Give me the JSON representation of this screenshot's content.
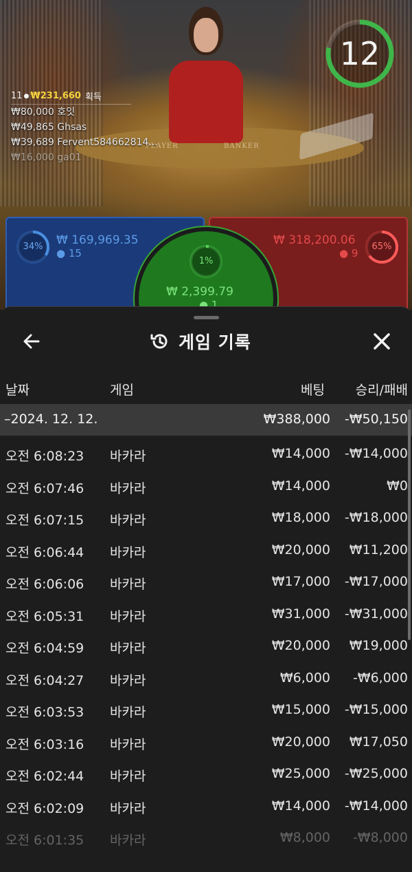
{
  "video": {
    "timer": "12",
    "table_player_text": "PLAYER",
    "table_banker_text": "BANKER",
    "winners_count": "11",
    "winners_total": "₩231,660",
    "winners_label": "획득",
    "winners": [
      {
        "amount": "₩80,000",
        "name": "호잇"
      },
      {
        "amount": "₩49,865",
        "name": "Ghsas"
      },
      {
        "amount": "₩39,689",
        "name": "Fervent584662814..."
      },
      {
        "amount": "₩16,000",
        "name": "ga01"
      }
    ]
  },
  "bets": {
    "player": {
      "pct": "34%",
      "amount": "₩ 169,969.35",
      "count": "15",
      "color": "#4a8fe0"
    },
    "tie": {
      "pct": "1%",
      "amount": "₩ 2,399.79",
      "count": "1",
      "color": "#59d259"
    },
    "banker": {
      "pct": "65%",
      "amount": "₩ 318,200.06",
      "count": "9",
      "color": "#ff5a5a"
    }
  },
  "history": {
    "title": "게임 기록",
    "icons": {
      "back": "arrow-left-icon",
      "history": "history-clock-icon",
      "close": "close-icon"
    },
    "columns": {
      "date": "날짜",
      "game": "게임",
      "bet": "베팅",
      "result": "승리/패배"
    },
    "date_group": {
      "date": "–2024. 12. 12.",
      "bet": "₩388,000",
      "result": "-₩50,150"
    },
    "rows": [
      {
        "time": "오전 6:08:23",
        "game": "바카라",
        "bet": "₩14,000",
        "result": "-₩14,000"
      },
      {
        "time": "오전 6:07:46",
        "game": "바카라",
        "bet": "₩14,000",
        "result": "₩0"
      },
      {
        "time": "오전 6:07:15",
        "game": "바카라",
        "bet": "₩18,000",
        "result": "-₩18,000"
      },
      {
        "time": "오전 6:06:44",
        "game": "바카라",
        "bet": "₩20,000",
        "result": "₩11,200"
      },
      {
        "time": "오전 6:06:06",
        "game": "바카라",
        "bet": "₩17,000",
        "result": "-₩17,000"
      },
      {
        "time": "오전 6:05:31",
        "game": "바카라",
        "bet": "₩31,000",
        "result": "-₩31,000"
      },
      {
        "time": "오전 6:04:59",
        "game": "바카라",
        "bet": "₩20,000",
        "result": "₩19,000"
      },
      {
        "time": "오전 6:04:27",
        "game": "바카라",
        "bet": "₩6,000",
        "result": "-₩6,000"
      },
      {
        "time": "오전 6:03:53",
        "game": "바카라",
        "bet": "₩15,000",
        "result": "-₩15,000"
      },
      {
        "time": "오전 6:03:16",
        "game": "바카라",
        "bet": "₩20,000",
        "result": "₩17,050"
      },
      {
        "time": "오전 6:02:44",
        "game": "바카라",
        "bet": "₩25,000",
        "result": "-₩25,000"
      },
      {
        "time": "오전 6:02:09",
        "game": "바카라",
        "bet": "₩14,000",
        "result": "-₩14,000"
      },
      {
        "time": "오전 6:01:35",
        "game": "바카라",
        "bet": "₩8,000",
        "result": "-₩8,000"
      }
    ]
  }
}
